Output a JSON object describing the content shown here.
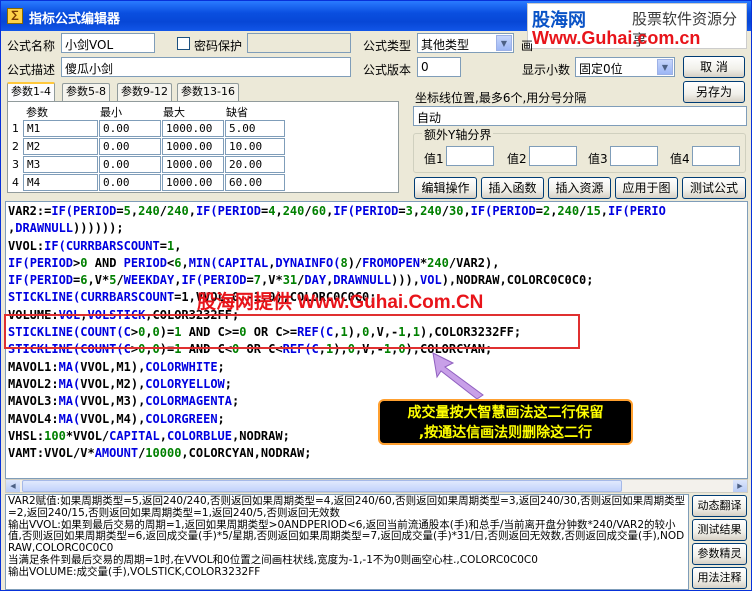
{
  "window": {
    "title": "指标公式编辑器"
  },
  "brand": {
    "name": "股海网",
    "slogan": "股票软件资源分享",
    "url": "Www.Guhai.com.cn"
  },
  "form": {
    "name_label": "公式名称",
    "name_value": "小剑VOL",
    "password_label": "密码保护",
    "password_value": "",
    "type_label": "公式类型",
    "type_value": "其他类型",
    "draw_label": "画",
    "desc_label": "公式描述",
    "desc_value": "傻瓜小剑",
    "version_label": "公式版本",
    "version_value": "0",
    "decimals_label": "显示小数",
    "decimals_value": "固定0位"
  },
  "buttons": {
    "ok": "确 定",
    "cancel": "取 消",
    "save_as": "另存为",
    "edit_ops": "编辑操作",
    "insert_func": "插入函数",
    "insert_res": "插入资源",
    "apply_chart": "应用于图",
    "test_formula": "测试公式"
  },
  "tabs": [
    {
      "label": "参数1-4",
      "active": true
    },
    {
      "label": "参数5-8",
      "active": false
    },
    {
      "label": "参数9-12",
      "active": false
    },
    {
      "label": "参数13-16",
      "active": false
    }
  ],
  "params": {
    "headers": [
      "参数",
      "最小",
      "最大",
      "缺省"
    ],
    "rows": [
      {
        "n": "1",
        "name": "M1",
        "min": "0.00",
        "max": "1000.00",
        "def": "5.00"
      },
      {
        "n": "2",
        "name": "M2",
        "min": "0.00",
        "max": "1000.00",
        "def": "10.00"
      },
      {
        "n": "3",
        "name": "M3",
        "min": "0.00",
        "max": "1000.00",
        "def": "20.00"
      },
      {
        "n": "4",
        "name": "M4",
        "min": "0.00",
        "max": "1000.00",
        "def": "60.00"
      }
    ]
  },
  "axis": {
    "label": "坐标线位置,最多6个,用分号分隔",
    "value": "自动",
    "extra_title": "额外Y轴分界",
    "v1": "值1",
    "v2": "值2",
    "v3": "值3",
    "v4": "值4"
  },
  "code": [
    [
      [
        "p",
        "VAR2:="
      ],
      [
        "k",
        "IF("
      ],
      [
        "k",
        "PERIOD"
      ],
      [
        "p",
        "="
      ],
      [
        "n",
        "5"
      ],
      [
        "p",
        ","
      ],
      [
        "n",
        "240"
      ],
      [
        "p",
        "/"
      ],
      [
        "n",
        "240"
      ],
      [
        "p",
        ","
      ],
      [
        "k",
        "IF("
      ],
      [
        "k",
        "PERIOD"
      ],
      [
        "p",
        "="
      ],
      [
        "n",
        "4"
      ],
      [
        "p",
        ","
      ],
      [
        "n",
        "240"
      ],
      [
        "p",
        "/"
      ],
      [
        "n",
        "60"
      ],
      [
        "p",
        ","
      ],
      [
        "k",
        "IF("
      ],
      [
        "k",
        "PERIOD"
      ],
      [
        "p",
        "="
      ],
      [
        "n",
        "3"
      ],
      [
        "p",
        ","
      ],
      [
        "n",
        "240"
      ],
      [
        "p",
        "/"
      ],
      [
        "n",
        "30"
      ],
      [
        "p",
        ","
      ],
      [
        "k",
        "IF("
      ],
      [
        "k",
        "PERIOD"
      ],
      [
        "p",
        "="
      ],
      [
        "n",
        "2"
      ],
      [
        "p",
        ","
      ],
      [
        "n",
        "240"
      ],
      [
        "p",
        "/"
      ],
      [
        "n",
        "15"
      ],
      [
        "p",
        ","
      ],
      [
        "k",
        "IF("
      ],
      [
        "k",
        "PERIO"
      ]
    ],
    [
      [
        "p",
        ","
      ],
      [
        "k",
        "DRAWNULL"
      ],
      [
        "p",
        "))))));"
      ]
    ],
    [
      [
        "p",
        "VVOL:"
      ],
      [
        "k",
        "IF("
      ],
      [
        "k",
        "CURRBARSCOUNT"
      ],
      [
        "p",
        "="
      ],
      [
        "n",
        "1"
      ],
      [
        "p",
        ","
      ]
    ],
    [
      [
        "k",
        "IF("
      ],
      [
        "k",
        "PERIOD"
      ],
      [
        "p",
        ">"
      ],
      [
        "n",
        "0"
      ],
      [
        "p",
        " AND "
      ],
      [
        "k",
        "PERIOD"
      ],
      [
        "p",
        "<"
      ],
      [
        "n",
        "6"
      ],
      [
        "p",
        ","
      ],
      [
        "k",
        "MIN("
      ],
      [
        "k",
        "CAPITAL"
      ],
      [
        "p",
        ","
      ],
      [
        "k",
        "DYNAINFO("
      ],
      [
        "n",
        "8"
      ],
      [
        "p",
        ")/"
      ],
      [
        "k",
        "FROMOPEN"
      ],
      [
        "p",
        "*"
      ],
      [
        "n",
        "240"
      ],
      [
        "p",
        "/VAR2),"
      ]
    ],
    [
      [
        "k",
        "IF("
      ],
      [
        "k",
        "PERIOD"
      ],
      [
        "p",
        "="
      ],
      [
        "n",
        "6"
      ],
      [
        "p",
        ",V*"
      ],
      [
        "n",
        "5"
      ],
      [
        "p",
        "/"
      ],
      [
        "k",
        "WEEKDAY"
      ],
      [
        "p",
        ","
      ],
      [
        "k",
        "IF("
      ],
      [
        "k",
        "PERIOD"
      ],
      [
        "p",
        "="
      ],
      [
        "n",
        "7"
      ],
      [
        "p",
        ",V*"
      ],
      [
        "n",
        "31"
      ],
      [
        "p",
        "/"
      ],
      [
        "k",
        "DAY"
      ],
      [
        "p",
        ","
      ],
      [
        "k",
        "DRAWNULL"
      ],
      [
        "p",
        ")))"
      ],
      [
        "p",
        ","
      ],
      [
        "k",
        "VOL"
      ],
      [
        "p",
        "),NODRAW,COLORC0C0C0;"
      ]
    ],
    [
      [
        "k",
        "STICKLINE("
      ],
      [
        "k",
        "CURRBARSCOUNT"
      ],
      [
        "p",
        "=1,VVOL,0,-1,0),COLORC0C0C0;"
      ]
    ],
    [
      [
        "p",
        "VOLUME:"
      ],
      [
        "k",
        "VOL"
      ],
      [
        "p",
        ","
      ],
      [
        "k",
        "VOLSTICK"
      ],
      [
        "p",
        ",COLOR3232FF;"
      ]
    ],
    [
      [
        "k",
        "STICKLINE("
      ],
      [
        "k",
        "COUNT("
      ],
      [
        "k",
        "C"
      ],
      [
        "p",
        ">"
      ],
      [
        "n",
        "0"
      ],
      [
        "p",
        ","
      ],
      [
        "n",
        "0"
      ],
      [
        "p",
        ")="
      ],
      [
        "n",
        "1"
      ],
      [
        "p",
        " AND C>="
      ],
      [
        "n",
        "0"
      ],
      [
        "p",
        " OR C>="
      ],
      [
        "k",
        "REF("
      ],
      [
        "k",
        "C"
      ],
      [
        "p",
        ","
      ],
      [
        "n",
        "1"
      ],
      [
        "p",
        "),"
      ],
      [
        "n",
        "0"
      ],
      [
        "p",
        ",V,-"
      ],
      [
        "n",
        "1"
      ],
      [
        "p",
        ","
      ],
      [
        "n",
        "1"
      ],
      [
        "p",
        "),COLOR3232FF;"
      ]
    ],
    [
      [
        "k",
        "STICKLINE("
      ],
      [
        "k",
        "COUNT("
      ],
      [
        "k",
        "C"
      ],
      [
        "p",
        ">"
      ],
      [
        "n",
        "0"
      ],
      [
        "p",
        ","
      ],
      [
        "n",
        "0"
      ],
      [
        "p",
        ")="
      ],
      [
        "n",
        "1"
      ],
      [
        "p",
        " AND C<"
      ],
      [
        "n",
        "0"
      ],
      [
        "p",
        " OR C<"
      ],
      [
        "k",
        "REF("
      ],
      [
        "k",
        "C"
      ],
      [
        "p",
        ","
      ],
      [
        "n",
        "1"
      ],
      [
        "p",
        "),"
      ],
      [
        "n",
        "0"
      ],
      [
        "p",
        ",V,-"
      ],
      [
        "n",
        "1"
      ],
      [
        "p",
        ","
      ],
      [
        "n",
        "0"
      ],
      [
        "p",
        "),COLORCYAN;"
      ]
    ],
    [
      [
        "p",
        "MAVOL1:"
      ],
      [
        "k",
        "MA("
      ],
      [
        "p",
        "VVOL,M1),"
      ],
      [
        "k",
        "COLORWHITE"
      ],
      [
        "p",
        ";"
      ]
    ],
    [
      [
        "p",
        "MAVOL2:"
      ],
      [
        "k",
        "MA("
      ],
      [
        "p",
        "VVOL,M2),"
      ],
      [
        "k",
        "COLORYELLOW"
      ],
      [
        "p",
        ";"
      ]
    ],
    [
      [
        "p",
        "MAVOL3:"
      ],
      [
        "k",
        "MA("
      ],
      [
        "p",
        "VVOL,M3),"
      ],
      [
        "k",
        "COLORMAGENTA"
      ],
      [
        "p",
        ";"
      ]
    ],
    [
      [
        "p",
        "MAVOL4:"
      ],
      [
        "k",
        "MA("
      ],
      [
        "p",
        "VVOL,M4),"
      ],
      [
        "k",
        "COLORGREEN"
      ],
      [
        "p",
        ";"
      ]
    ],
    [
      [
        "p",
        "VHSL:"
      ],
      [
        "n",
        "100"
      ],
      [
        "p",
        "*VVOL/"
      ],
      [
        "k",
        "CAPITAL"
      ],
      [
        "p",
        ","
      ],
      [
        "k",
        "COLORBLUE"
      ],
      [
        "p",
        ",NODRAW;"
      ]
    ],
    [
      [
        "p",
        "VAMT:VVOL/V*"
      ],
      [
        "k",
        "AMOUNT"
      ],
      [
        "p",
        "/"
      ],
      [
        "n",
        "10000"
      ],
      [
        "p",
        ",COLORCYAN,NODRAW;"
      ]
    ]
  ],
  "watermark": "股海网提供 Www.Guhai.Com.CN",
  "note": {
    "line1": "成交量按大智慧画法这二行保留",
    "line2": ",按通达信画法则删除这二行"
  },
  "description": "VAR2赋值:如果周期类型=5,返回240/240,否则返回如果周期类型=4,返回240/60,否则返回如果周期类型=3,返回240/30,否则返回如果周期类型=2,返回240/15,否则返回如果周期类型=1,返回240/5,否则返回无效数\n输出VVOL:如果到最后交易的周期=1,返回如果周期类型>0ANDPERIOD<6,返回当前流通股本(手)和总手/当前离开盘分钟数*240/VAR2的较小值,否则返回如果周期类型=6,返回成交量(手)*5/星期,否则返回如果周期类型=7,返回成交量(手)*31/日,否则返回无效数,否则返回成交量(手),NODRAW,COLORC0C0C0\n当满足条件到最后交易的周期=1时,在VVOL和0位置之间画柱状线,宽度为-1,-1不为0则画空心柱.,COLORC0C0C0\n输出VOLUME:成交量(手),VOLSTICK,COLOR3232FF",
  "side_buttons": [
    "动态翻译",
    "测试结果",
    "参数精灵",
    "用法注释"
  ],
  "colors": {
    "title_bar": "#0A4FE0",
    "keyword": "#0000E0",
    "number": "#008000",
    "highlight_box": "#E03030",
    "note_text": "#FFFF00"
  }
}
